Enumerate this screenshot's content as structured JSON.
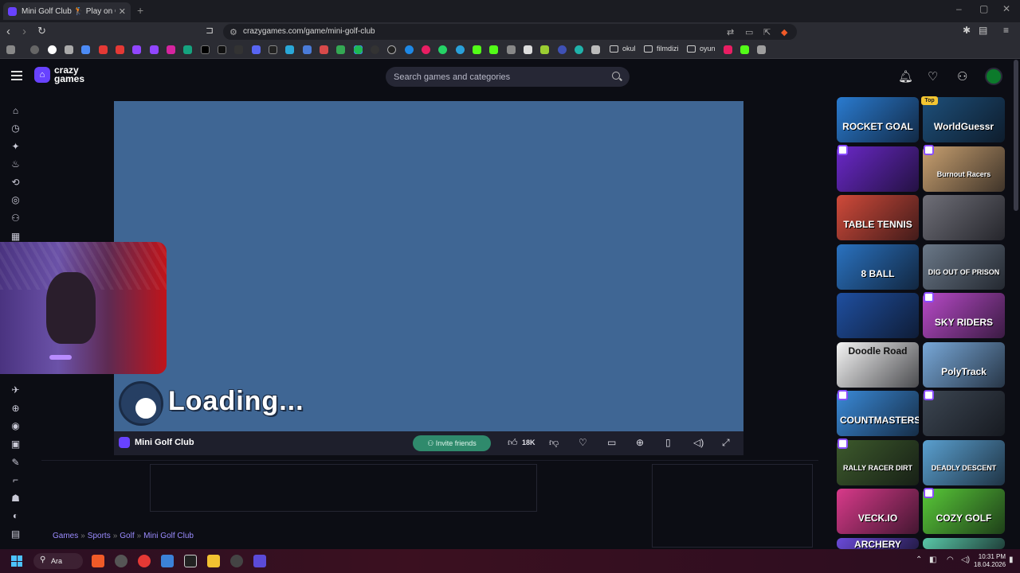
{
  "browser": {
    "tab_title": "Mini Golf Club 🏌 Play on CrazyGames",
    "url": "crazygames.com/game/mini-golf-club",
    "bookmarks": [
      "okul",
      "filmdizi",
      "oyun"
    ]
  },
  "site": {
    "logo_top": "crazy",
    "logo_bottom": "games",
    "search_placeholder": "Search games and categories"
  },
  "game": {
    "loading_text": "Loading...",
    "title": "Mini Golf Club",
    "invite_label": "Invite friends",
    "likes": "18K"
  },
  "breadcrumb": [
    "Games",
    "Sports",
    "Golf",
    "Mini Golf Club"
  ],
  "sidebar_thumbnails": [
    {
      "label": "ROCKET GOAL",
      "color": "#2a7bd0"
    },
    {
      "label": "WorldGuessr",
      "color": "#1d4f7a",
      "badge": "Top"
    },
    {
      "label": "",
      "color": "#6a28c8"
    },
    {
      "label": "Burnout Racers",
      "color": "#c8a070"
    },
    {
      "label": "TABLE TENNIS",
      "color": "#d04a3a"
    },
    {
      "label": "",
      "color": "#6f6f78"
    },
    {
      "label": "8 BALL",
      "color": "#2a72c0"
    },
    {
      "label": "DIG OUT OF PRISON",
      "color": "#6a7888"
    },
    {
      "label": "",
      "color": "#1f4fa0"
    },
    {
      "label": "SKY RIDERS",
      "color": "#b84ac8"
    },
    {
      "label": "Doodle Road",
      "color": "#f4f4f4"
    },
    {
      "label": "PolyTrack",
      "color": "#78a8d8"
    },
    {
      "label": "COUNTMASTERS",
      "color": "#3a8ad8"
    },
    {
      "label": "",
      "color": "#3c4652"
    },
    {
      "label": "RALLY RACER DIRT",
      "color": "#3d5a2c"
    },
    {
      "label": "DEADLY DESCENT",
      "color": "#5aa0d0"
    },
    {
      "label": "VECK.IO",
      "color": "#d83a8a"
    },
    {
      "label": "COZY GOLF",
      "color": "#58c838"
    },
    {
      "label": "ARCHERY",
      "color": "#6a4ad8"
    },
    {
      "label": "",
      "color": "#5ac8a8"
    }
  ],
  "taskbar": {
    "search_label": "Ara",
    "time": "10:31 PM",
    "date": "18.04.2026"
  }
}
